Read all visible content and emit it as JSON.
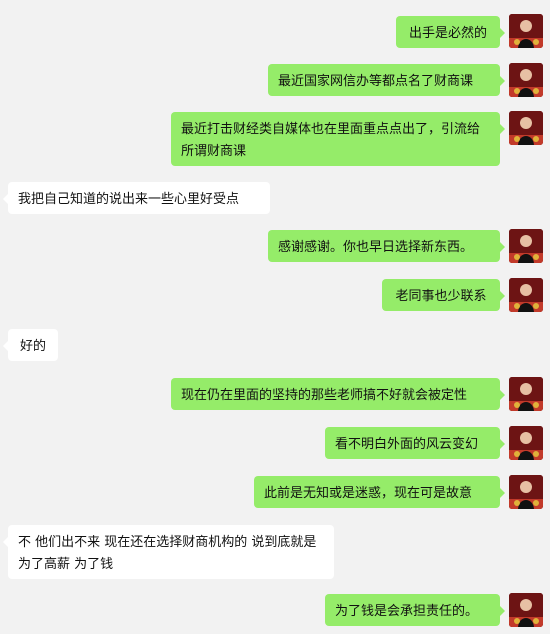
{
  "messages": [
    {
      "side": "out",
      "text": "出手是必然的"
    },
    {
      "side": "out",
      "text": "最近国家网信办等都点名了财商课"
    },
    {
      "side": "out",
      "text": "最近打击财经类自媒体也在里面重点点出了，引流给所谓财商课"
    },
    {
      "side": "in",
      "text": "我把自己知道的说出来一些心里好受点"
    },
    {
      "side": "out",
      "text": "感谢感谢。你也早日选择新东西。"
    },
    {
      "side": "out",
      "text": "老同事也少联系"
    },
    {
      "side": "in",
      "text": "好的"
    },
    {
      "side": "out",
      "text": "现在仍在里面的坚持的那些老师搞不好就会被定性"
    },
    {
      "side": "out",
      "text": "看不明白外面的风云变幻"
    },
    {
      "side": "out",
      "text": "此前是无知或是迷惑，现在可是故意"
    },
    {
      "side": "in",
      "text": "不 他们出不来 现在还在选择财商机构的 说到底就是为了高薪 为了钱"
    },
    {
      "side": "out",
      "text": "为了钱是会承担责任的。"
    }
  ],
  "colors": {
    "outgoing_bubble": "#95ec69",
    "incoming_bubble": "#ffffff",
    "background": "#f2f2f2"
  },
  "avatar_icon": "user-avatar-icon"
}
